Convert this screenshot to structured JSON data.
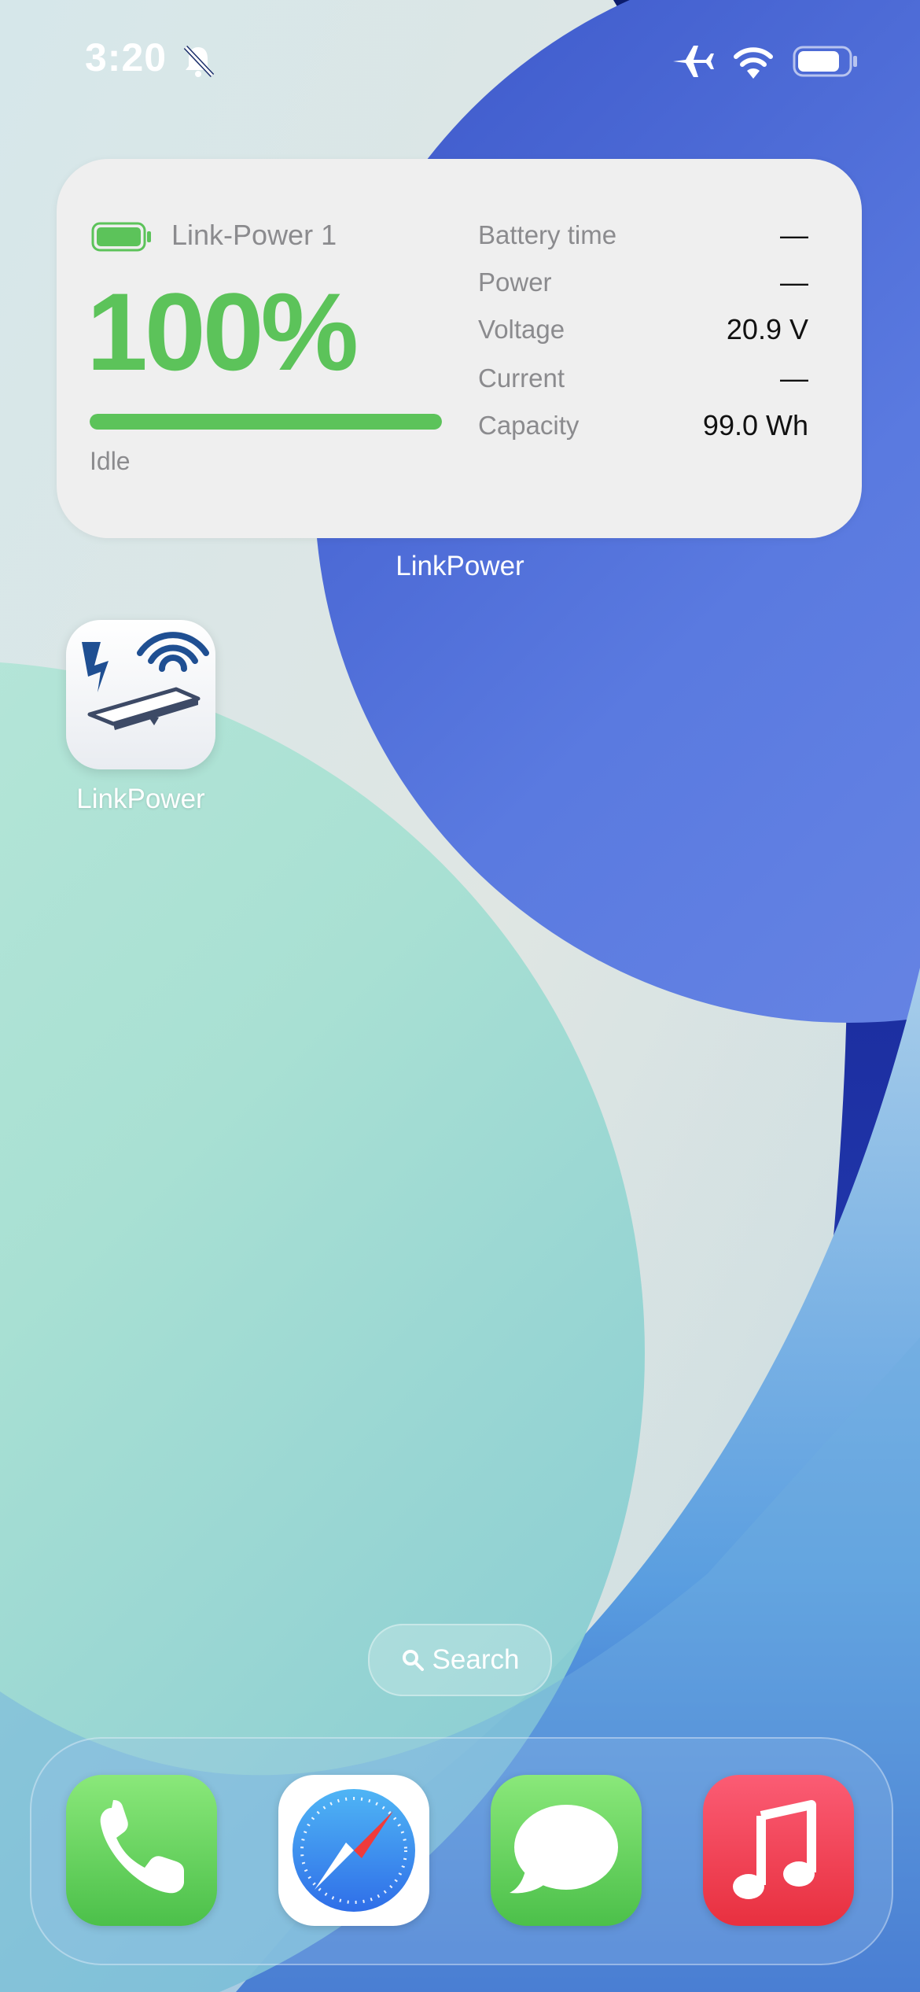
{
  "status_bar": {
    "time": "3:20"
  },
  "widget": {
    "device_name": "Link-Power 1",
    "percent": "100%",
    "level_fraction": 1.0,
    "state": "Idle",
    "stats": [
      {
        "label": "Battery time",
        "value": "—"
      },
      {
        "label": "Power",
        "value": "—"
      },
      {
        "label": "Voltage",
        "value": "20.9 V"
      },
      {
        "label": "Current",
        "value": "—"
      },
      {
        "label": "Capacity",
        "value": "99.0 Wh"
      }
    ],
    "caption": "LinkPower",
    "accent_color": "#5cc35a"
  },
  "home": {
    "apps": [
      {
        "label": "LinkPower",
        "icon": "linkpower-icon"
      }
    ],
    "search_label": "Search"
  },
  "dock": {
    "apps": [
      {
        "name": "phone",
        "icon": "phone-icon"
      },
      {
        "name": "safari",
        "icon": "compass-icon"
      },
      {
        "name": "messages",
        "icon": "speech-bubble-icon"
      },
      {
        "name": "music",
        "icon": "music-note-icon"
      }
    ]
  }
}
